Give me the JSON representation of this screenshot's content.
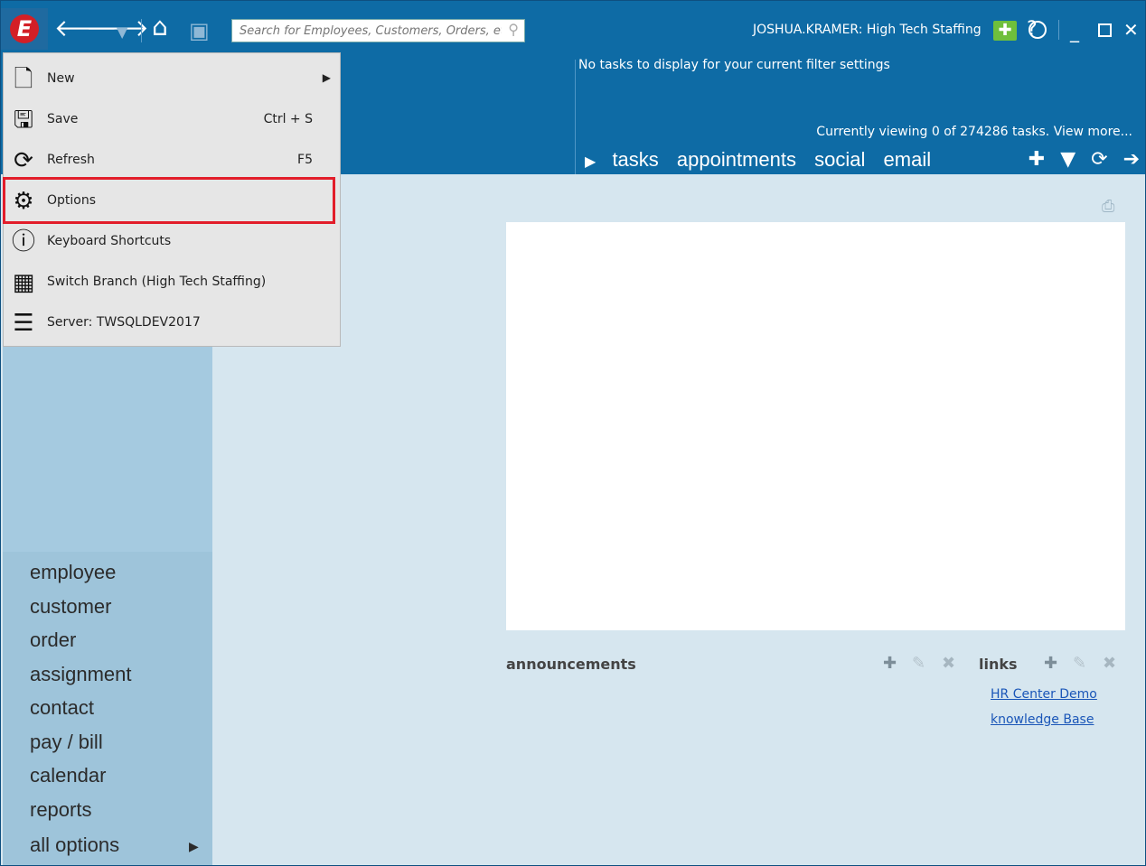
{
  "titlebar": {
    "logo_letter": "E",
    "search_placeholder": "Search for Employees, Customers, Orders, etc.",
    "user_branch": "JOSHUA.KRAMER: High Tech Staffing"
  },
  "tasks": {
    "empty_message": "No tasks to display for your current filter settings",
    "viewing_status": "Currently viewing 0 of 274286 tasks. View more...",
    "tabs": [
      "tasks",
      "appointments",
      "social",
      "email"
    ]
  },
  "menu": {
    "items": [
      {
        "label": "New",
        "shortcut": "",
        "submenu": true,
        "icon": "new-document-icon"
      },
      {
        "label": "Save",
        "shortcut": "Ctrl + S",
        "icon": "save-icon"
      },
      {
        "label": "Refresh",
        "shortcut": "F5",
        "icon": "refresh-icon"
      },
      {
        "label": "Options",
        "shortcut": "",
        "icon": "gear-icon",
        "highlighted": true
      },
      {
        "label": "Keyboard Shortcuts",
        "shortcut": "",
        "icon": "help-icon"
      },
      {
        "label": "Switch Branch (High Tech Staffing)",
        "shortcut": "",
        "icon": "building-icon"
      },
      {
        "label": "Server: TWSQLDEV2017",
        "shortcut": "",
        "icon": "server-icon"
      }
    ],
    "highlight_color": "#e21d2a"
  },
  "nav": {
    "items": [
      "employee",
      "customer",
      "order",
      "assignment",
      "contact",
      "pay / bill",
      "calendar",
      "reports",
      "all options"
    ]
  },
  "widgets": {
    "announcements_title": "announcements",
    "links_title": "links",
    "links": [
      "HR Center Demo",
      "knowledge Base"
    ]
  },
  "colors": {
    "titlebar": "#0e6ba5",
    "accent_logo": "#d31f26"
  }
}
